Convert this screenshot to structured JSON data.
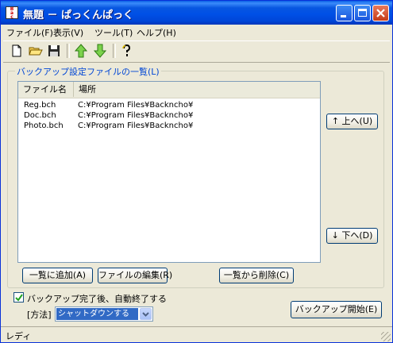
{
  "window": {
    "title": "無題 － ぱっくんぱっく",
    "icon": "app-icon"
  },
  "menu": [
    {
      "label": "ファイル(F)"
    },
    {
      "label": "表示(V)"
    },
    {
      "label": "ツール(T)"
    },
    {
      "label": "ヘルプ(H)"
    }
  ],
  "toolbar": {
    "icons": [
      "new-document-icon",
      "open-folder-icon",
      "save-icon",
      "move-up-arrow-icon",
      "move-down-arrow-icon",
      "help-icon"
    ]
  },
  "group": {
    "title": "バックアップ設定ファイルの一覧(L)",
    "columns": [
      "ファイル名",
      "場所"
    ],
    "rows": [
      {
        "name": "Reg.bch",
        "location": "C:¥Program Files¥Backncho¥"
      },
      {
        "name": "Doc.bch",
        "location": "C:¥Program Files¥Backncho¥"
      },
      {
        "name": "Photo.bch",
        "location": "C:¥Program Files¥Backncho¥"
      }
    ],
    "up_button": "↑ 上へ(U)",
    "down_button": "↓ 下へ(D)",
    "add_button": "一覧に追加(A)",
    "edit_button": "ファイルの編集(R)",
    "delete_button": "一覧から削除(C)"
  },
  "options": {
    "auto_exit_label": "バックアップ完了後、自動終了する",
    "auto_exit_checked": true,
    "method_label": "[方法]",
    "method_value": "シャットダウンする"
  },
  "start_button": "バックアップ開始(E)",
  "status": "レディ",
  "colors": {
    "titlebar": "#0050e6",
    "accent": "#0046d5",
    "selection": "#316ac5"
  }
}
